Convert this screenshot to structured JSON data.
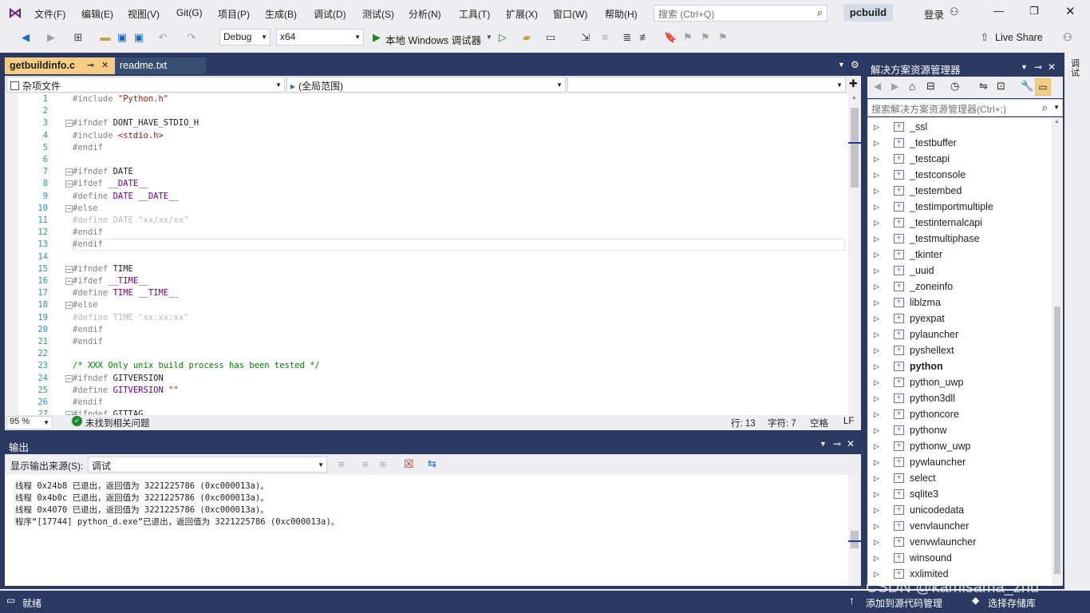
{
  "menu": [
    "文件(F)",
    "编辑(E)",
    "视图(V)",
    "Git(G)",
    "项目(P)",
    "生成(B)",
    "调试(D)",
    "测试(S)",
    "分析(N)",
    "工具(T)",
    "扩展(X)",
    "窗口(W)",
    "帮助(H)"
  ],
  "search": {
    "placeholder": "搜索 (Ctrl+Q)"
  },
  "project_badge": "pcbuild",
  "login": "登录",
  "toolbar": {
    "config": "Debug",
    "platform": "x64",
    "run_label": "本地 Windows 调试器",
    "live_share": "Live Share"
  },
  "tabs": [
    {
      "label": "getbuildinfo.c",
      "active": true
    },
    {
      "label": "readme.txt",
      "active": false
    }
  ],
  "nav": {
    "project": "杂项文件",
    "scope": "(全局范围)",
    "member": ""
  },
  "code": [
    {
      "n": "1",
      "t": "#include \"Python.h\""
    },
    {
      "n": "2",
      "t": ""
    },
    {
      "n": "3",
      "t": "#ifndef DONT_HAVE_STDIO_H"
    },
    {
      "n": "4",
      "t": "#include <stdio.h>"
    },
    {
      "n": "5",
      "t": "#endif"
    },
    {
      "n": "6",
      "t": ""
    },
    {
      "n": "7",
      "t": "#ifndef DATE"
    },
    {
      "n": "8",
      "t": "#ifdef __DATE__"
    },
    {
      "n": "9",
      "t": "#define DATE __DATE__"
    },
    {
      "n": "10",
      "t": "#else"
    },
    {
      "n": "11",
      "t": "#define DATE \"xx/xx/xx\""
    },
    {
      "n": "12",
      "t": "#endif"
    },
    {
      "n": "13",
      "t": "#endif"
    },
    {
      "n": "14",
      "t": ""
    },
    {
      "n": "15",
      "t": "#ifndef TIME"
    },
    {
      "n": "16",
      "t": "#ifdef __TIME__"
    },
    {
      "n": "17",
      "t": "#define TIME __TIME__"
    },
    {
      "n": "18",
      "t": "#else"
    },
    {
      "n": "19",
      "t": "#define TIME \"xx:xx:xx\""
    },
    {
      "n": "20",
      "t": "#endif"
    },
    {
      "n": "21",
      "t": "#endif"
    },
    {
      "n": "22",
      "t": ""
    },
    {
      "n": "23",
      "t": "/* XXX Only unix build process has been tested */"
    },
    {
      "n": "24",
      "t": "#ifndef GITVERSION"
    },
    {
      "n": "25",
      "t": "#define GITVERSION \"\""
    },
    {
      "n": "26",
      "t": "#endif"
    },
    {
      "n": "27",
      "t": "#ifndef GITTAG"
    }
  ],
  "editor_status": {
    "zoom": "95 %",
    "issues": "未找到相关问题",
    "line": "行: 13",
    "col": "字符: 7",
    "ws": "空格",
    "eol": "LF"
  },
  "output": {
    "title": "输出",
    "source_label": "显示输出来源(S):",
    "source_value": "调试",
    "lines": [
      "线程 0x24b8 已退出，返回值为 3221225786 (0xc000013a)。",
      "线程 0x4b0c 已退出，返回值为 3221225786 (0xc000013a)。",
      "线程 0x4070 已退出，返回值为 3221225786 (0xc000013a)。",
      "程序“[17744] python_d.exe”已退出，返回值为 3221225786 (0xc000013a)。"
    ]
  },
  "solution_explorer": {
    "title": "解决方案资源管理器",
    "search_placeholder": "搜索解决方案资源管理器(Ctrl+;)",
    "items": [
      "_ssl",
      "_testbuffer",
      "_testcapi",
      "_testconsole",
      "_testembed",
      "_testimportmultiple",
      "_testinternalcapi",
      "_testmultiphase",
      "_tkinter",
      "_uuid",
      "_zoneinfo",
      "liblzma",
      "pyexpat",
      "pylauncher",
      "pyshellext",
      "python",
      "python_uwp",
      "python3dll",
      "pythoncore",
      "pythonw",
      "pythonw_uwp",
      "pywlauncher",
      "select",
      "sqlite3",
      "unicodedata",
      "venvlauncher",
      "venvwlauncher",
      "winsound",
      "xxlimited"
    ],
    "bold_item": "python"
  },
  "side_strip": "调试",
  "status": {
    "ready": "就绪",
    "add_source": "添加到源代码管理",
    "select_repo": "选择存储库",
    "watermark": "CSDN @kamisama_zhu"
  },
  "colors": {
    "accent": "#2b3a62",
    "tab_active": "#f5cc84"
  }
}
